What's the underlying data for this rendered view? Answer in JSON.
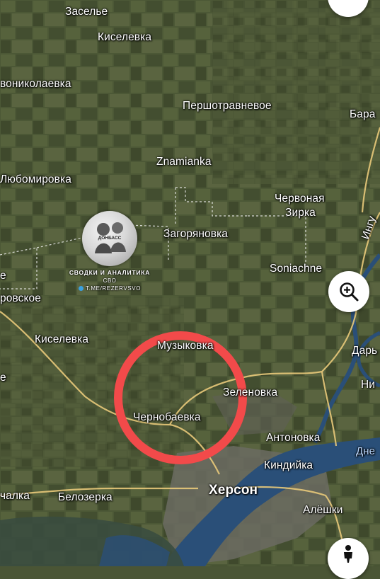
{
  "map": {
    "type": "satellite",
    "place_labels": [
      {
        "id": "zaselye",
        "text": "Заселье"
      },
      {
        "id": "kiselevka-n",
        "text": "Киселевка"
      },
      {
        "id": "novonikolaevka",
        "text": "вониколаевка"
      },
      {
        "id": "pershotravnevoe",
        "text": "Першотравневое"
      },
      {
        "id": "bara",
        "text": "Бара"
      },
      {
        "id": "znamianka",
        "text": "Znamianka"
      },
      {
        "id": "lyubomirovka",
        "text": "Любомировка"
      },
      {
        "id": "chervonaya-1",
        "text": "Червоная"
      },
      {
        "id": "chervonaya-2",
        "text": "Зирка"
      },
      {
        "id": "zagoryanovka",
        "text": "Загоряновка"
      },
      {
        "id": "soniachne",
        "text": "Soniachne"
      },
      {
        "id": "e-edge",
        "text": "е"
      },
      {
        "id": "rovskoe",
        "text": "ровское"
      },
      {
        "id": "kiselevka-s",
        "text": "Киселевка"
      },
      {
        "id": "muzykovka",
        "text": "Музыковка"
      },
      {
        "id": "darya",
        "text": "Дарь"
      },
      {
        "id": "e-edge-2",
        "text": "е"
      },
      {
        "id": "zelenovka",
        "text": "Зеленовка"
      },
      {
        "id": "ni",
        "text": "Ни"
      },
      {
        "id": "chernobaevka",
        "text": "Чернобаевка"
      },
      {
        "id": "antonovka",
        "text": "Антоновка"
      },
      {
        "id": "dne",
        "text": "Дне"
      },
      {
        "id": "kindiyka",
        "text": "Киндийка"
      },
      {
        "id": "khersion",
        "text": "Херсон"
      },
      {
        "id": "chalka",
        "text": "чалка"
      },
      {
        "id": "belozerka",
        "text": "Белозерка"
      },
      {
        "id": "aleshki",
        "text": "Алёшки"
      },
      {
        "id": "ingul",
        "text": "Ингу"
      }
    ],
    "highlight_color": "#f24a4a",
    "road_color": "#e8c97a",
    "river_color": "#2a4f78"
  },
  "watermark": {
    "logo_text": "ДОНБАСС",
    "line1": "СВОДКИ И АНАЛИТИКА",
    "line2": "СВО",
    "line3": "T.ME/REZERVSVO"
  },
  "controls": {
    "zoom_icon": "zoom-in-icon",
    "person_icon": "street-view-person-icon"
  }
}
